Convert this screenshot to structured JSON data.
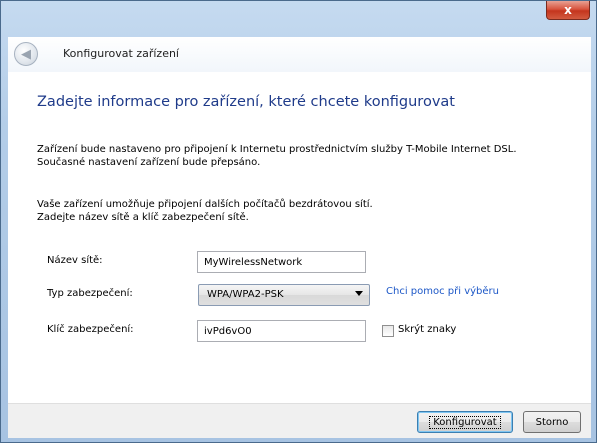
{
  "window": {
    "close_glyph": "x"
  },
  "header": {
    "back_icon": "back-arrow-icon",
    "title": "Konfigurovat zařízení"
  },
  "main": {
    "heading": "Zadejte informace pro zařízení, které chcete konfigurovat",
    "para1_line1": "Zařízení bude nastaveno pro připojení k Internetu prostřednictvím služby T-Mobile Internet DSL.",
    "para1_line2": "Současné nastavení zařízení bude přepsáno.",
    "para2_line1": "Vaše zařízení umožňuje připojení dalších počítačů bezdrátovou sítí.",
    "para2_line2": "Zadejte název sítě a klíč zabezpečení sítě."
  },
  "form": {
    "network_name_label": "Název sítě:",
    "network_name_value": "MyWirelessNetwork",
    "security_type_label": "Typ zabezpečení:",
    "security_type_value": "WPA/WPA2-PSK",
    "help_link": "Chci pomoc při výběru",
    "security_key_label": "Klíč zabezpečení:",
    "security_key_value": "ivPd6vO0",
    "hide_chars_label": "Skrýt znaky",
    "hide_chars_checked": false
  },
  "footer": {
    "configure_label": "Konfigurovat",
    "cancel_label": "Storno"
  },
  "colors": {
    "heading": "#1f3b8a",
    "link": "#1c57c7",
    "close_button": "#c4351e"
  }
}
